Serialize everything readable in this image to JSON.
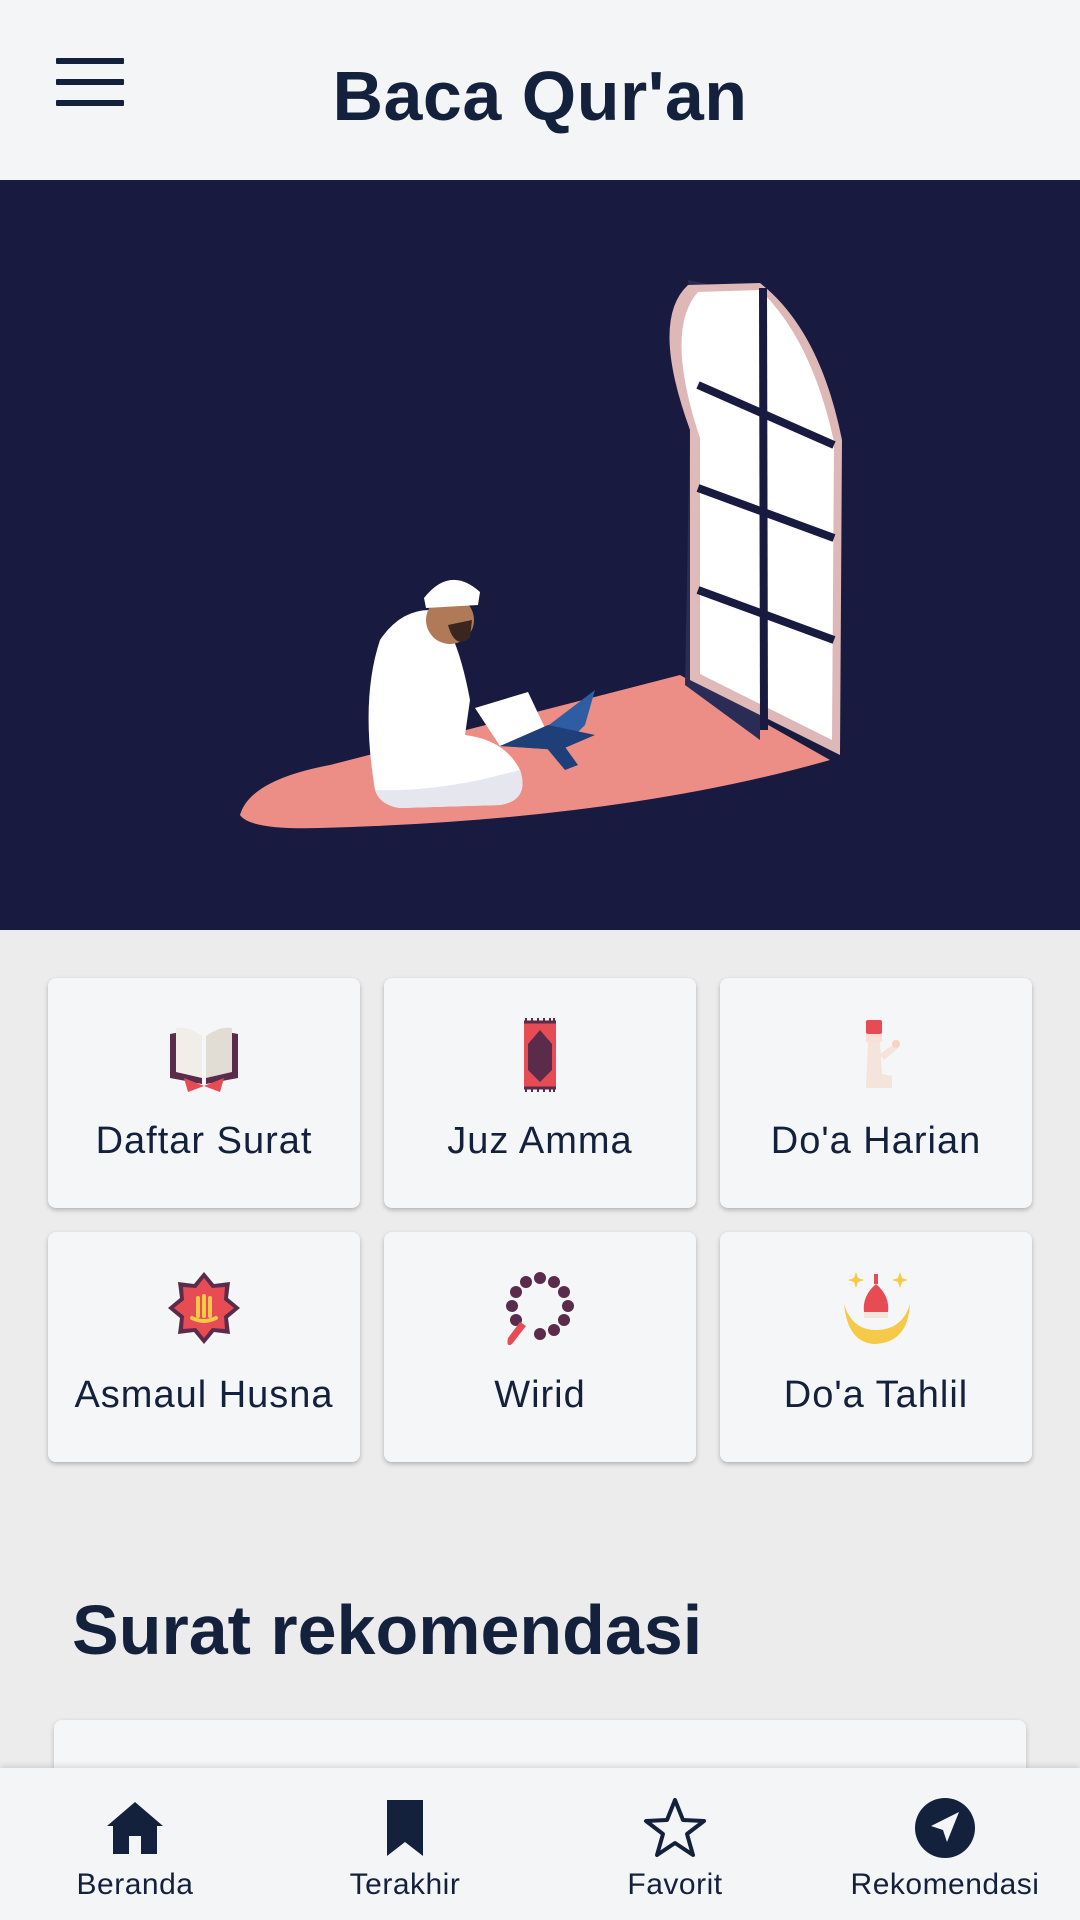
{
  "app_bar": {
    "title": "Baca Qur'an",
    "menu_icon": "hamburger-menu-icon"
  },
  "hero": {
    "illustration": "man-reading-quran-by-window-illustration",
    "background_color": "#191a3f"
  },
  "menu_tiles": [
    {
      "label": "Daftar Surat",
      "icon": "open-book-icon"
    },
    {
      "label": "Juz Amma",
      "icon": "prayer-rug-icon"
    },
    {
      "label": "Do'a Harian",
      "icon": "praying-person-icon"
    },
    {
      "label": "Asmaul Husna",
      "icon": "allah-calligraphy-star-icon"
    },
    {
      "label": "Wirid",
      "icon": "prayer-beads-icon"
    },
    {
      "label": "Do'a Tahlil",
      "icon": "crescent-mosque-icon"
    }
  ],
  "recommendation": {
    "title": "Surat rekomendasi"
  },
  "bottom_nav": [
    {
      "label": "Beranda",
      "icon": "home-icon"
    },
    {
      "label": "Terakhir",
      "icon": "bookmark-icon"
    },
    {
      "label": "Favorit",
      "icon": "star-icon"
    },
    {
      "label": "Rekomendasi",
      "icon": "navigation-arrow-icon"
    }
  ],
  "colors": {
    "primary_text": "#14213d",
    "app_bar_bg": "#f4f5f7",
    "page_bg": "#ececec",
    "accent_salmon": "#ec8e86"
  }
}
